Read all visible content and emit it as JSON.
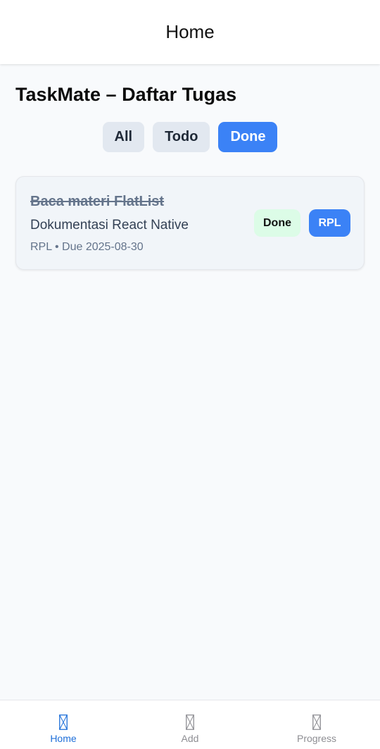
{
  "header": {
    "title": "Home"
  },
  "main": {
    "title": "TaskMate – Daftar Tugas",
    "filters": [
      {
        "label": "All",
        "active": false
      },
      {
        "label": "Todo",
        "active": false
      },
      {
        "label": "Done",
        "active": true
      }
    ],
    "tasks": [
      {
        "title": "Baca materi FlatList",
        "description": "Dokumentasi React Native",
        "meta": "RPL • Due 2025-08-30",
        "status": "Done",
        "category": "RPL",
        "completed": true
      }
    ]
  },
  "tabbar": {
    "items": [
      {
        "label": "Home",
        "icon": "missing-glyph-icon",
        "active": true
      },
      {
        "label": "Add",
        "icon": "missing-glyph-icon",
        "active": false
      },
      {
        "label": "Progress",
        "icon": "missing-glyph-icon",
        "active": false
      }
    ]
  },
  "colors": {
    "accent": "#3b82f6",
    "tab_active": "#1e6fd9",
    "tab_inactive": "#8e8e93",
    "done_badge_bg": "#dcfce7",
    "background": "#f8fafc"
  }
}
